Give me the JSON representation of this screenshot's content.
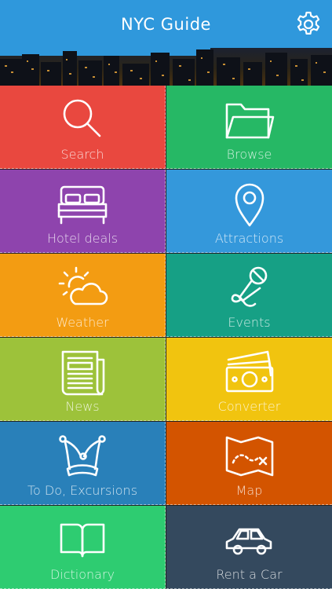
{
  "header": {
    "title": "NYC Guide",
    "settings_icon": "gear-icon"
  },
  "colors": {
    "header": "#2f98dc"
  },
  "tiles": [
    {
      "label": "Search",
      "icon": "magnifier-icon",
      "color": "#e9483f"
    },
    {
      "label": "Browse",
      "icon": "folder-icon",
      "color": "#26b865"
    },
    {
      "label": "Hotel deals",
      "icon": "bed-icon",
      "color": "#8e44ad"
    },
    {
      "label": "Attractions",
      "icon": "map-pin-icon",
      "color": "#3498db"
    },
    {
      "label": "Weather",
      "icon": "sun-cloud-icon",
      "color": "#f39c12"
    },
    {
      "label": "Events",
      "icon": "microphone-icon",
      "color": "#16a085"
    },
    {
      "label": "News",
      "icon": "newspaper-icon",
      "color": "#9dc23a"
    },
    {
      "label": "Converter",
      "icon": "money-icon",
      "color": "#f1c40f"
    },
    {
      "label": "To Do, Excursions",
      "icon": "jester-hat-icon",
      "color": "#2980b9"
    },
    {
      "label": "Map",
      "icon": "treasure-map-icon",
      "color": "#d35400"
    },
    {
      "label": "Dictionary",
      "icon": "open-book-icon",
      "color": "#2ecc71"
    },
    {
      "label": "Rent a Car",
      "icon": "car-icon",
      "color": "#34495e"
    }
  ]
}
